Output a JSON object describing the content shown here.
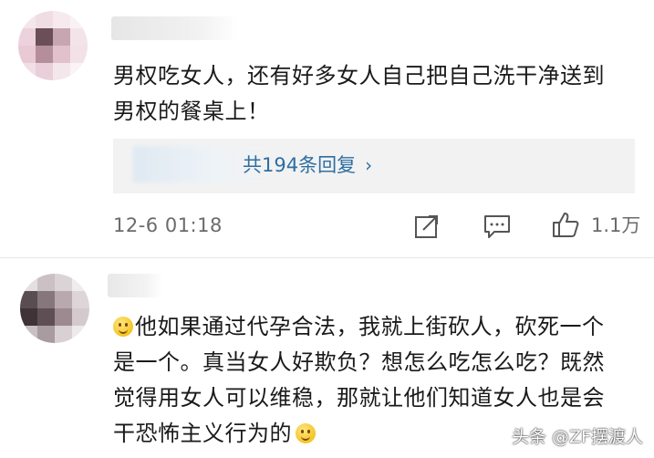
{
  "comments": [
    {
      "text_lines": [
        "男权吃女人，还有好多女人自己把自己洗干净送到",
        "男权的餐桌上！"
      ],
      "reply_link": "共194条回复",
      "time": "12-6 01:18",
      "likes": "1.1万",
      "icons": [
        "share-icon",
        "comment-icon",
        "like-icon"
      ]
    },
    {
      "text_lines": [
        "他如果通过代孕合法，我就上街砍人，砍死一个",
        "是一个。真当女人好欺负？想怎么吃怎么吃？既然",
        "觉得用女人可以维稳，那就让他们知道女人也是会",
        "干恐怖主义行为的"
      ],
      "emoji": "smile-emoji"
    }
  ],
  "watermark": "头条 @ZF摆渡人",
  "colors": {
    "link": "#2e6ea3",
    "meta": "#6b6b6b",
    "reply_bg": "#f2f2f2"
  }
}
